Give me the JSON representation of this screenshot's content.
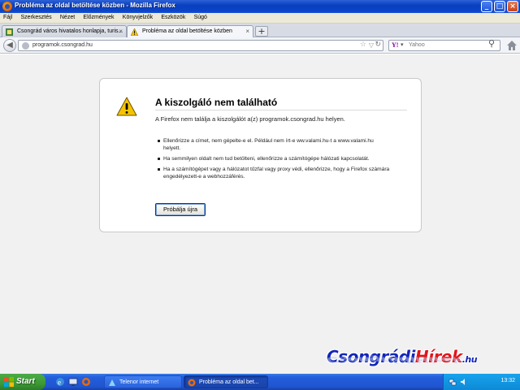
{
  "window": {
    "title": "Probléma az oldal betöltése közben - Mozilla Firefox",
    "controls": [
      "minimize",
      "maximize",
      "close"
    ]
  },
  "menu": {
    "items": [
      "Fájl",
      "Szerkesztés",
      "Nézet",
      "Előzmények",
      "Könyvjelzők",
      "Eszközök",
      "Súgó"
    ]
  },
  "tabs": [
    {
      "label": "Csongrád város hivatalos honlapja, turis...",
      "icon": "site-favicon",
      "active": false
    },
    {
      "label": "Probléma az oldal betöltése közben",
      "icon": "warning-icon",
      "active": true
    }
  ],
  "nav": {
    "url": "programok.csongrad.hu",
    "search_placeholder": "Yahoo",
    "search_engine_icon": "Y!"
  },
  "error": {
    "title": "A kiszolgáló nem található",
    "description": "A Firefox nem találja a kiszolgálót a(z) programok.csongrad.hu helyen.",
    "items": [
      "Ellenőrizze a címet, nem gépelte-e el. Például nem írt-e ww.valami.hu-t a www.valami.hu helyett.",
      "Ha semmilyen oldalt nem tud betölteni, ellenőrizze a számítógépe hálózati kapcsolatát.",
      "Ha a számítógépet vagy a hálózatot tűzfal vagy proxy védi, ellenőrizze, hogy a Firefox számára engedélyezett-e a webhozzáférés."
    ],
    "retry_label": "Próbálja újra"
  },
  "watermark": {
    "part1": "Csongrádi",
    "part2": "Hírek",
    "suffix": ".hu"
  },
  "taskbar": {
    "start_label": "Start",
    "buttons": [
      {
        "label": "Telenor internet"
      },
      {
        "label": "Probléma az oldal bet..."
      }
    ],
    "clock": "13:32"
  },
  "colors": {
    "titlebar": "#0a3fbf",
    "taskbar": "#245edb",
    "start": "#3c9a35",
    "warning": "#f5c400",
    "watermark_blue": "#1226b8",
    "watermark_red": "#e2141b"
  }
}
